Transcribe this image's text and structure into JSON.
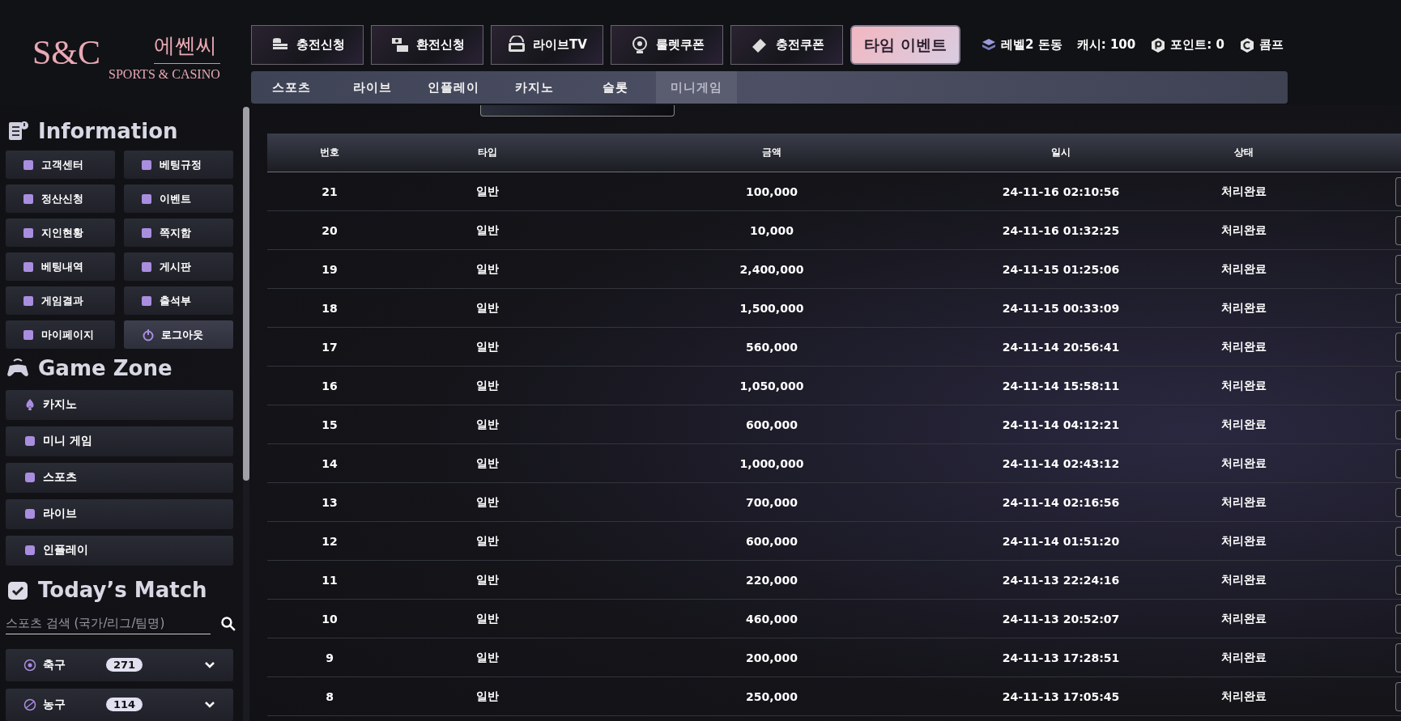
{
  "logo": {
    "monogram": "S&C",
    "name": "에쎈씨",
    "tagline": "SPORTS & CASINO"
  },
  "top_buttons": [
    {
      "label": "충전신청"
    },
    {
      "label": "환전신청"
    },
    {
      "label": "라이브TV"
    },
    {
      "label": "룰렛쿠폰"
    },
    {
      "label": "충전쿠폰"
    }
  ],
  "event_button": {
    "label": "타임 이벤트"
  },
  "user_info": [
    {
      "text": "레벨2 돈동"
    },
    {
      "text": "캐시: 100"
    },
    {
      "text": "포인트: 0"
    },
    {
      "text": "콤프"
    }
  ],
  "nav_tabs": [
    {
      "label": "스포츠",
      "selected": false
    },
    {
      "label": "라이브",
      "selected": false
    },
    {
      "label": "인플레이",
      "selected": false
    },
    {
      "label": "카지노",
      "selected": false
    },
    {
      "label": "슬롯",
      "selected": false
    },
    {
      "label": "미니게임",
      "selected": true
    }
  ],
  "sidebar": {
    "information": {
      "title": "Information",
      "items": [
        {
          "label": "고객센터",
          "selected": false
        },
        {
          "label": "베팅규정",
          "selected": false
        },
        {
          "label": "정산신청",
          "selected": false
        },
        {
          "label": "이벤트",
          "selected": false
        },
        {
          "label": "지인현황",
          "selected": false
        },
        {
          "label": "쪽지함",
          "selected": false
        },
        {
          "label": "베팅내역",
          "selected": false
        },
        {
          "label": "게시판",
          "selected": false
        },
        {
          "label": "게임결과",
          "selected": false
        },
        {
          "label": "출석부",
          "selected": false
        },
        {
          "label": "마이페이지",
          "selected": false
        },
        {
          "label": "로그아웃",
          "selected": true
        }
      ]
    },
    "game_zone": {
      "title": "Game Zone",
      "items": [
        {
          "label": "카지노"
        },
        {
          "label": "미니 게임"
        },
        {
          "label": "스포츠"
        },
        {
          "label": "라이브"
        },
        {
          "label": "인플레이"
        }
      ]
    },
    "todays_match": {
      "title": "Today’s Match",
      "search_placeholder": "스포츠 검색 (국가/리그/팀명)",
      "sports": [
        {
          "name": "축구",
          "count": "271"
        },
        {
          "name": "농구",
          "count": "114"
        }
      ]
    }
  },
  "table": {
    "columns": [
      "번호",
      "타입",
      "금액",
      "일시",
      "상태"
    ],
    "rows": [
      [
        "21",
        "일반",
        "100,000",
        "24-11-16 02:10:56",
        "처리완료"
      ],
      [
        "20",
        "일반",
        "10,000",
        "24-11-16 01:32:25",
        "처리완료"
      ],
      [
        "19",
        "일반",
        "2,400,000",
        "24-11-15 01:25:06",
        "처리완료"
      ],
      [
        "18",
        "일반",
        "1,500,000",
        "24-11-15 00:33:09",
        "처리완료"
      ],
      [
        "17",
        "일반",
        "560,000",
        "24-11-14 20:56:41",
        "처리완료"
      ],
      [
        "16",
        "일반",
        "1,050,000",
        "24-11-14 15:58:11",
        "처리완료"
      ],
      [
        "15",
        "일반",
        "600,000",
        "24-11-14 04:12:21",
        "처리완료"
      ],
      [
        "14",
        "일반",
        "1,000,000",
        "24-11-14 02:43:12",
        "처리완료"
      ],
      [
        "13",
        "일반",
        "700,000",
        "24-11-14 02:16:56",
        "처리완료"
      ],
      [
        "12",
        "일반",
        "600,000",
        "24-11-14 01:51:20",
        "처리완료"
      ],
      [
        "11",
        "일반",
        "220,000",
        "24-11-13 22:24:16",
        "처리완료"
      ],
      [
        "10",
        "일반",
        "460,000",
        "24-11-13 20:52:07",
        "처리완료"
      ],
      [
        "9",
        "일반",
        "200,000",
        "24-11-13 17:28:51",
        "처리완료"
      ],
      [
        "8",
        "일반",
        "250,000",
        "24-11-13 17:05:45",
        "처리완료"
      ]
    ]
  }
}
